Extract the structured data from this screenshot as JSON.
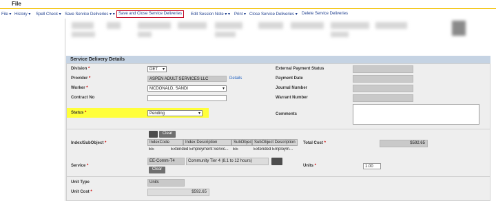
{
  "titlebar": {
    "file": "File"
  },
  "menu": {
    "file": "File ▾",
    "history": "History ▾",
    "spell_check": "Spell Check ▾",
    "save_sd": "Save Service Deliveries ▾ ▾",
    "save_close": "Save and Close Service Deliveries",
    "edit_note": "Edit Session Note ▾ ▾",
    "print": "Print ▾",
    "close_sd": "Close Service Deliveries ▾",
    "delete_sd": "Delete Service Deliveries"
  },
  "section": {
    "title": "Service Delivery Details"
  },
  "form": {
    "division_label": "Division",
    "division_value": "DET",
    "provider_label": "Provider",
    "provider_value": "ASPEN ADULT SERVICES LLC",
    "details_link": "Details",
    "worker_label": "Worker",
    "worker_value": "MCDONALD, SANDI",
    "contract_label": "Contract No",
    "contract_value": "",
    "status_label": "Status",
    "status_value": "Pending",
    "ext_pay_label": "External Payment Status",
    "pay_date_label": "Payment Date",
    "journal_label": "Journal Number",
    "warrant_label": "Warrant Number",
    "comments_label": "Comments",
    "index_label": "Index/SubObject",
    "clear_label": "Clear",
    "grid_headers": [
      "IndexCode",
      "Index Description",
      "SubObject",
      "SubObject Description"
    ],
    "grid_row": [
      "EE",
      "Extended Employment Servic...",
      "EE",
      "Extended Employm..."
    ],
    "total_cost_label": "Total Cost",
    "total_cost_value": "$592.65",
    "service_label": "Service",
    "service_code": "EE-Comm-T4",
    "service_desc": "Community Tier 4 (8.1 to 12 hours)",
    "units_label": "Units",
    "units_value": "1.00",
    "unit_type_label": "Unit Type",
    "unit_type_value": "Units",
    "unit_cost_label": "Unit Cost",
    "unit_cost_value": "$592.65",
    "req_mark": "*"
  }
}
